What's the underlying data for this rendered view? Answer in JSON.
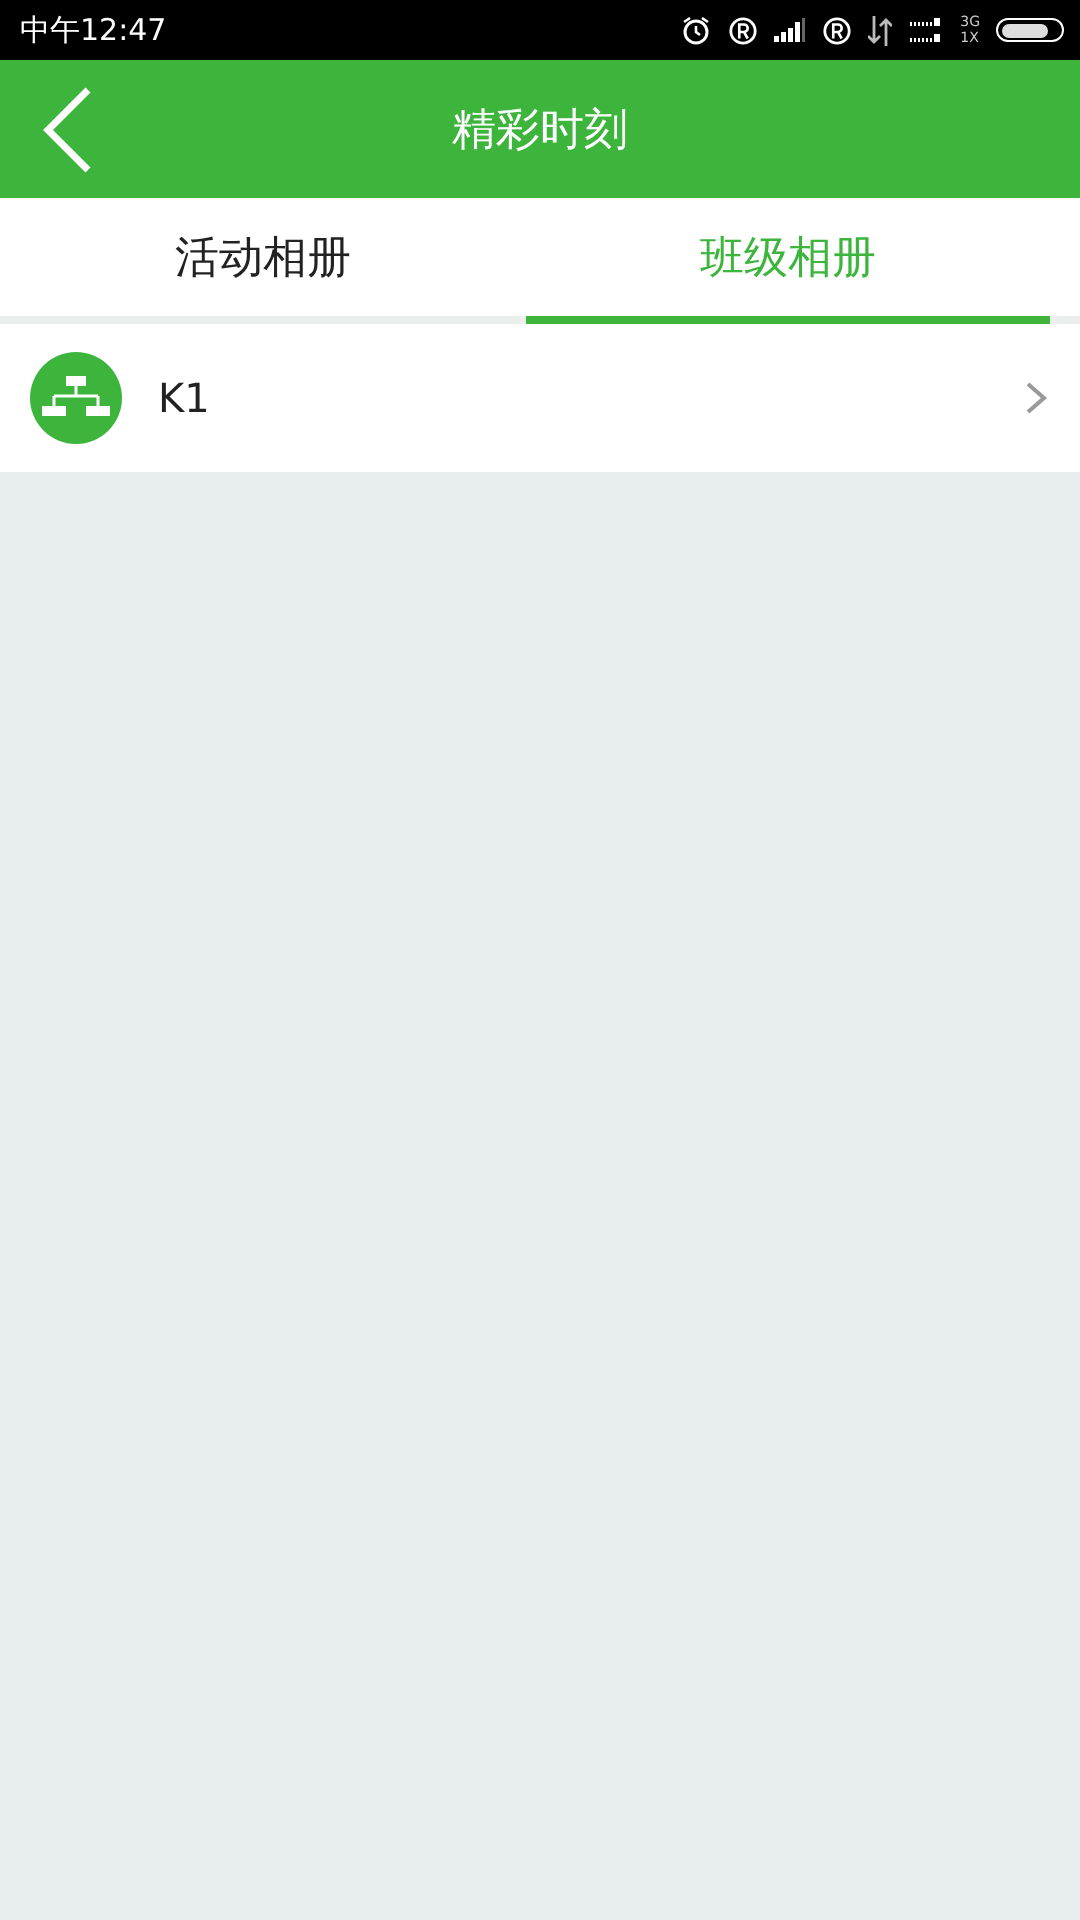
{
  "status_bar": {
    "time": "中午12:47",
    "network_top": "3G",
    "network_bottom": "1X"
  },
  "header": {
    "title": "精彩时刻"
  },
  "tabs": [
    {
      "label": "活动相册",
      "selected": false
    },
    {
      "label": "班级相册",
      "selected": true
    }
  ],
  "items": [
    {
      "name": "K1"
    }
  ]
}
